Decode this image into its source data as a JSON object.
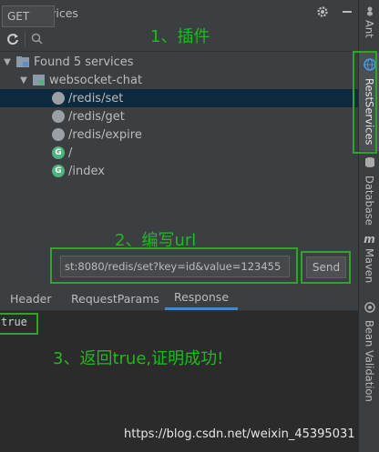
{
  "panel": {
    "title": "RestServices"
  },
  "tree": {
    "root_label": "Found 5 services",
    "module_label": "websocket-chat",
    "endpoints": [
      {
        "path": "/redis/set",
        "method_icon": "circle",
        "selected": true
      },
      {
        "path": "/redis/get",
        "method_icon": "circle"
      },
      {
        "path": "/redis/expire",
        "method_icon": "circle"
      },
      {
        "path": "/",
        "method_icon": "G"
      },
      {
        "path": "/index",
        "method_icon": "G"
      }
    ]
  },
  "request": {
    "method": "GET",
    "url": "st:8080/redis/set?key=id&value=123455",
    "send_label": "Send"
  },
  "tabs": [
    "Header",
    "RequestParams",
    "Response"
  ],
  "active_tab": "Response",
  "response": {
    "body": "true"
  },
  "annotations": {
    "step1": "1、插件",
    "step2": "2、编写url",
    "step3": "3、返回true,证明成功!"
  },
  "side_tabs": [
    "Ant",
    "RestServices",
    "Database",
    "Maven",
    "Bean Validation"
  ],
  "watermark": "https://blog.csdn.net/weixin_45395031",
  "colors": {
    "annotation": "#1fba1f",
    "selection": "#0d293e",
    "tab_underline": "#4a88c7"
  }
}
